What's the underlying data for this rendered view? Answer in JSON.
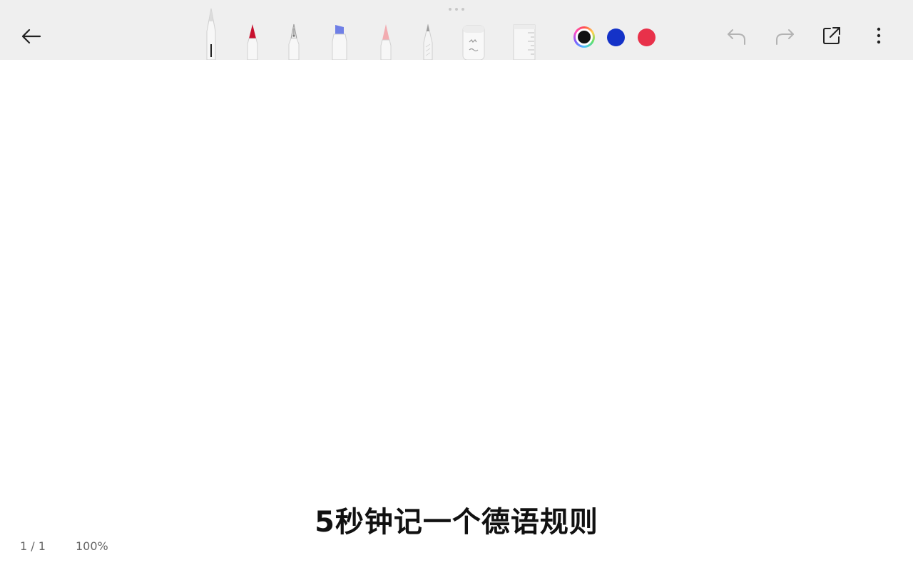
{
  "toolbar": {
    "back_icon": "arrow-left-icon",
    "tools": [
      {
        "name": "ballpoint-pen",
        "icon": "ballpoint-pen-icon"
      },
      {
        "name": "marker-red",
        "icon": "marker-pen-icon",
        "color": "#c8102e"
      },
      {
        "name": "fountain-pen",
        "icon": "fountain-pen-icon"
      },
      {
        "name": "highlighter",
        "icon": "highlighter-icon",
        "color": "#6f7fe6"
      },
      {
        "name": "airbrush",
        "icon": "brush-pen-icon",
        "color": "#f2a0a6"
      },
      {
        "name": "pencil",
        "icon": "pencil-icon"
      },
      {
        "name": "eraser",
        "icon": "eraser-icon"
      },
      {
        "name": "ruler",
        "icon": "ruler-icon"
      }
    ],
    "colors": [
      {
        "name": "black",
        "hex": "#111111",
        "selected": true
      },
      {
        "name": "blue",
        "hex": "#1432c8",
        "selected": false
      },
      {
        "name": "red",
        "hex": "#e8314a",
        "selected": false
      }
    ],
    "actions": [
      {
        "name": "undo",
        "icon": "undo-icon",
        "enabled": false
      },
      {
        "name": "redo",
        "icon": "redo-icon",
        "enabled": false
      },
      {
        "name": "share",
        "icon": "share-icon",
        "enabled": true
      },
      {
        "name": "more",
        "icon": "more-vertical-icon",
        "enabled": true
      }
    ]
  },
  "canvas": {
    "caption": "5秒钟记一个德语规则"
  },
  "footer": {
    "page_indicator": "1 / 1",
    "zoom": "100%"
  }
}
